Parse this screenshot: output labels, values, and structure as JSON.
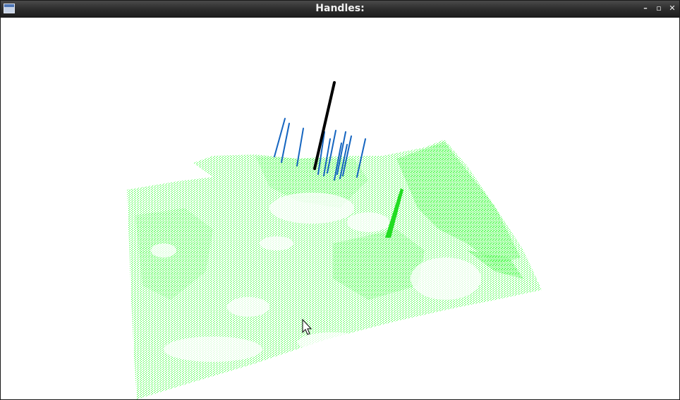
{
  "window": {
    "title": "Handles:",
    "buttons": {
      "minimize": "–",
      "maximize": "▫",
      "close": "✕"
    }
  },
  "scene": {
    "point_cloud_color": "#33ff33",
    "handle_color": "#1565c0",
    "selected_handle_color": "#000000",
    "background": "#ffffff"
  }
}
